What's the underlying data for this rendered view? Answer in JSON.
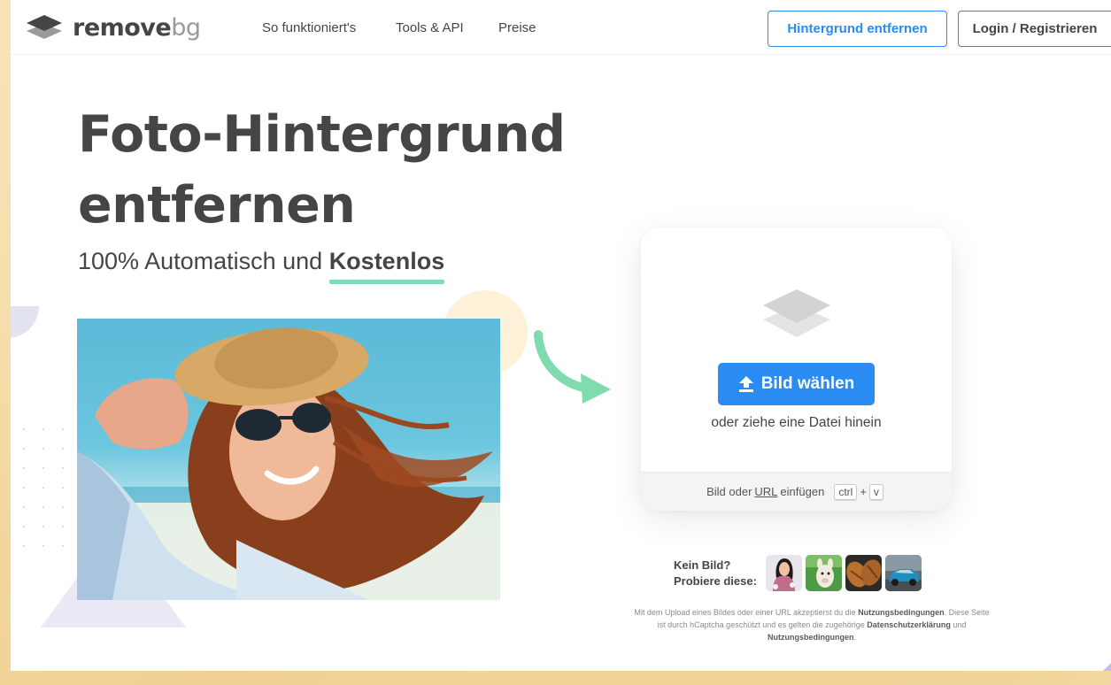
{
  "nav": {
    "logo_main": "remove",
    "logo_suffix": "bg",
    "links": [
      "So funktioniert's",
      "Tools & API",
      "Preise"
    ],
    "cta_remove": "Hintergrund entfernen",
    "cta_login": "Login / Registrieren"
  },
  "hero": {
    "title_line1": "Foto-Hintergrund",
    "title_line2": "entfernen",
    "subtitle_prefix": "100% Automatisch und ",
    "subtitle_emphasis": "Kostenlos"
  },
  "upload": {
    "button_label": "Bild wählen",
    "drop_text": "oder ziehe eine Datei hinein",
    "paste_prefix": "Bild oder ",
    "paste_url": "URL",
    "paste_suffix": " einfügen",
    "key_ctrl": "ctrl",
    "key_plus": "+",
    "key_v": "v"
  },
  "samples": {
    "line1": "Kein Bild?",
    "line2": "Probiere diese:"
  },
  "legal": {
    "part1": "Mit dem Upload eines Bildes oder einer URL akzeptierst du die ",
    "link1": "Nutzungsbedingungen",
    "part2": ". Diese Seite ist durch hCaptcha geschützt und es gelten die zugehörige ",
    "link2": "Datenschutzerklärung",
    "part3": " und ",
    "link3": "Nutzungsbedingungen",
    "part4": "."
  },
  "colors": {
    "accent_blue": "#2a8bf2",
    "text_dark": "#454545",
    "underline_green": "#7bdcb5",
    "arrow_green": "#7fdcae"
  }
}
